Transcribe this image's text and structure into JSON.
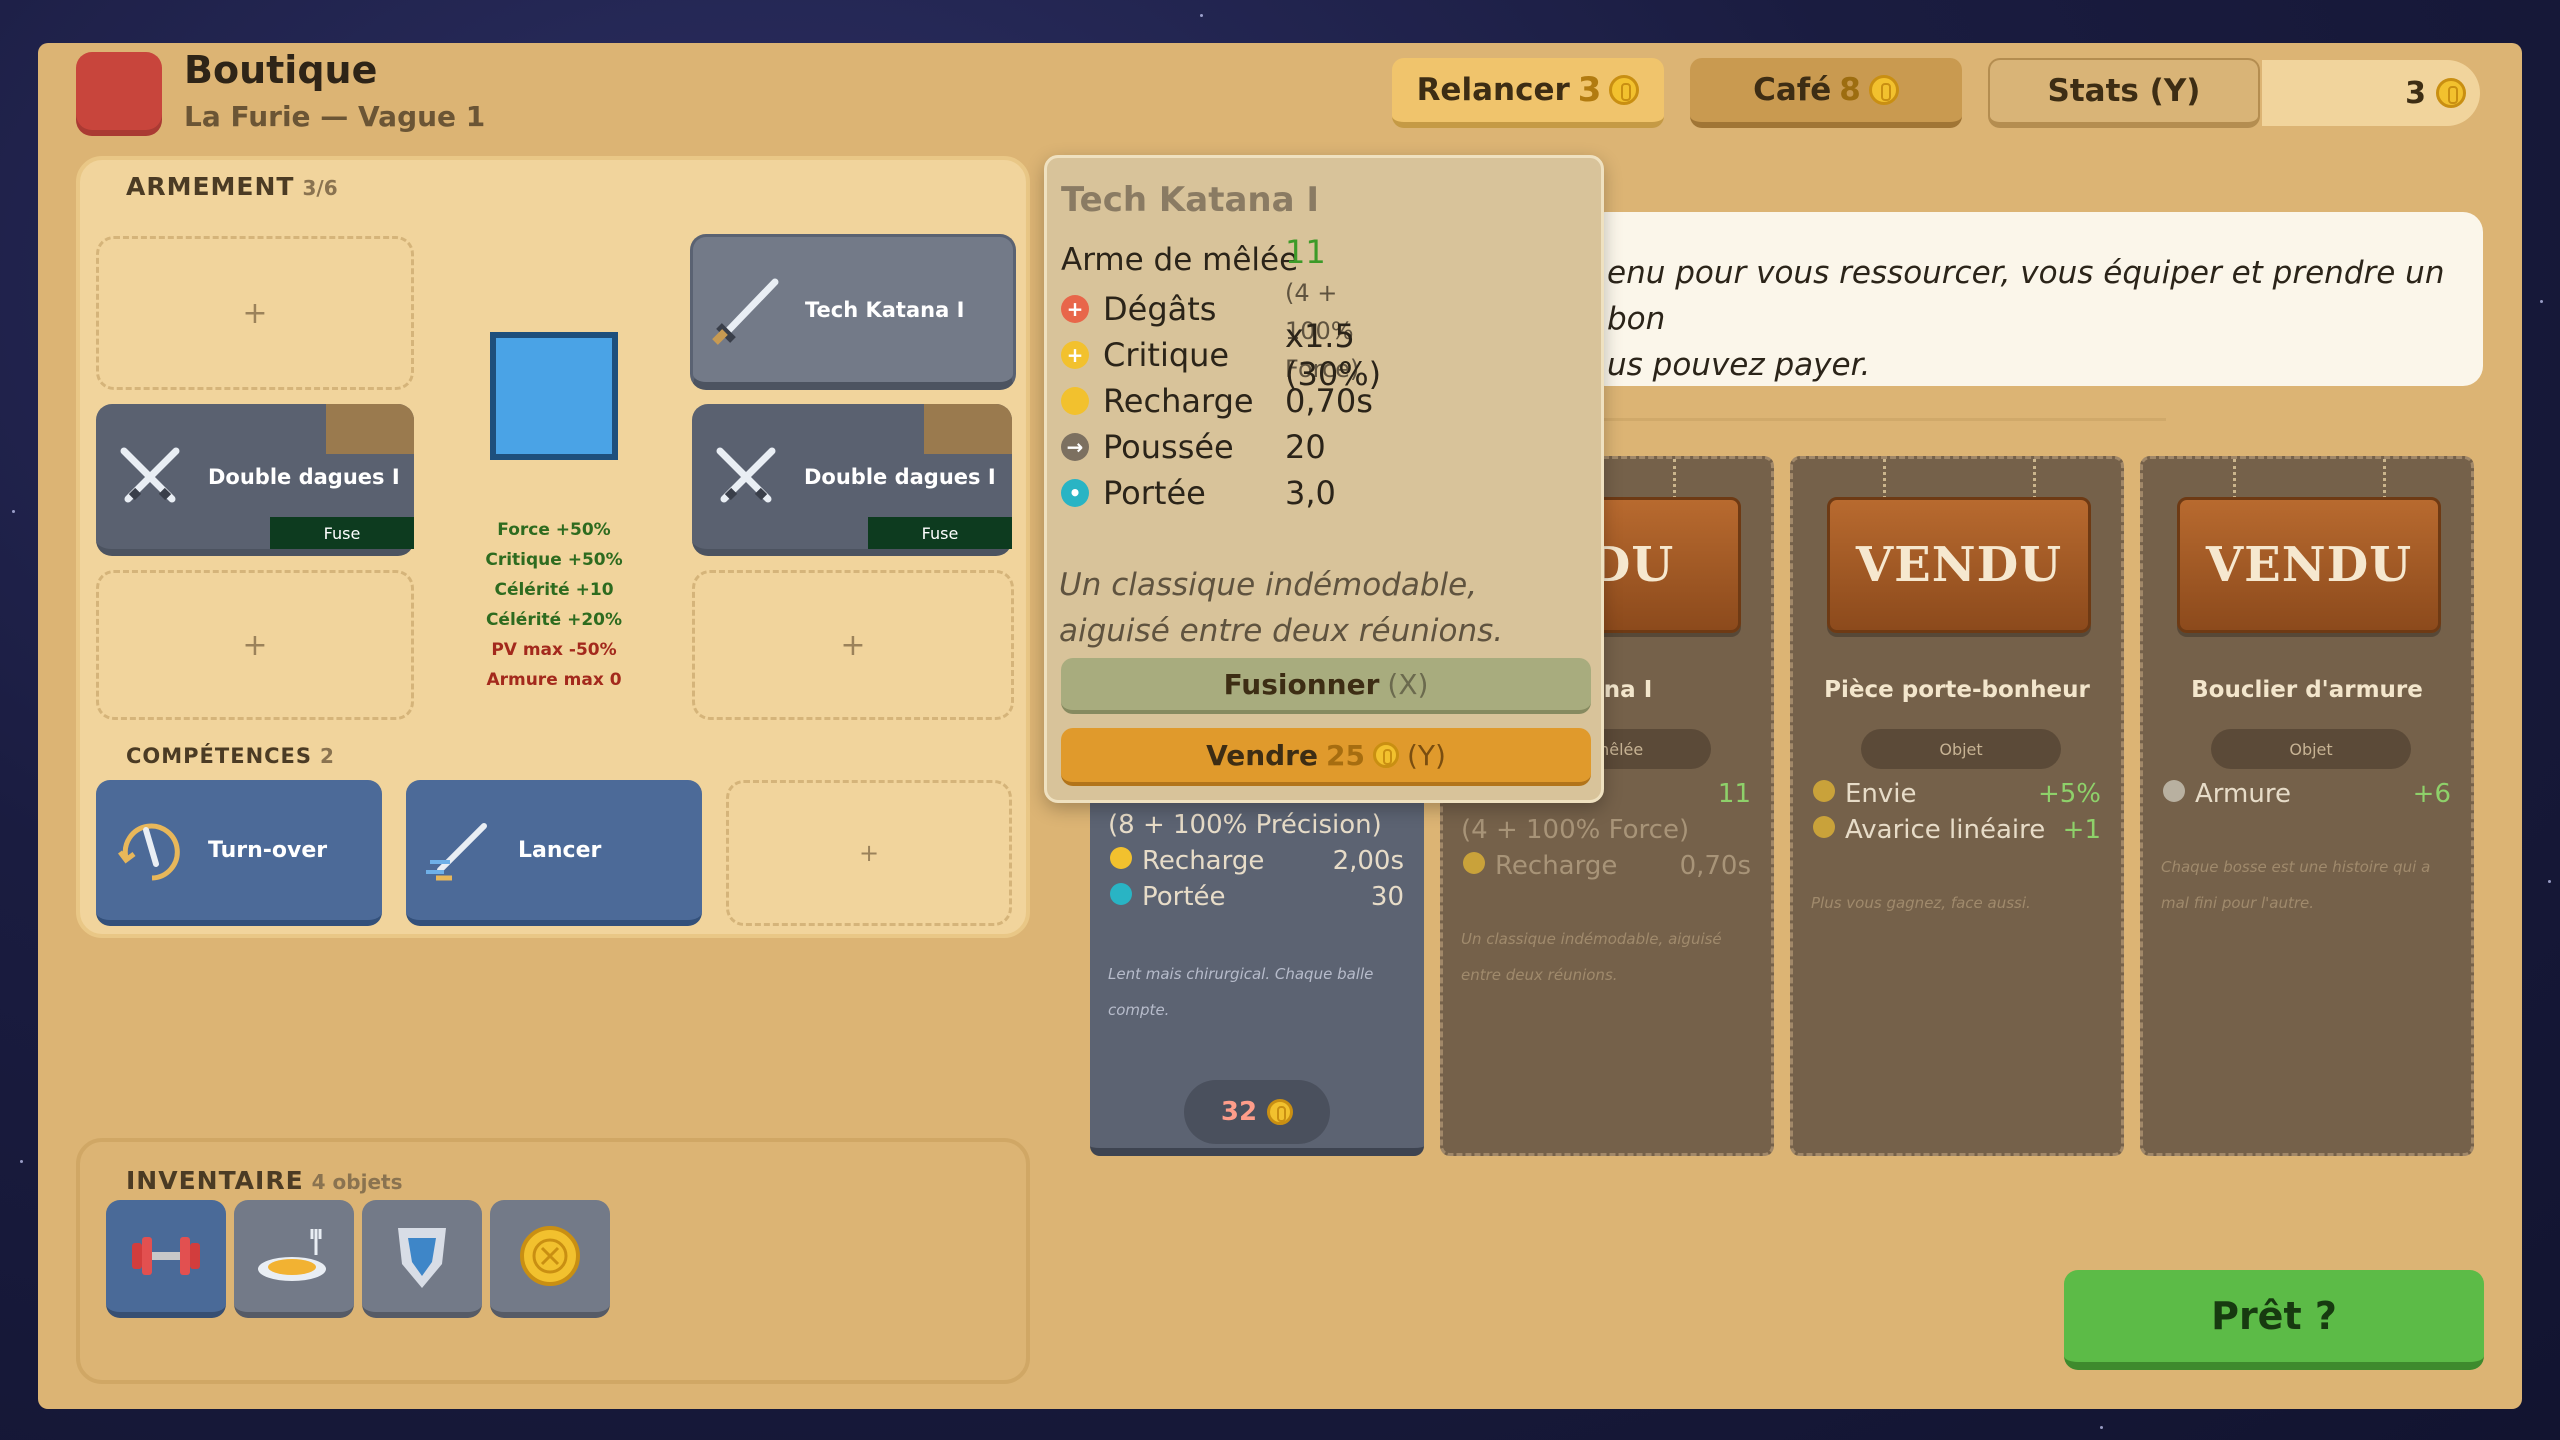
{
  "header": {
    "title": "Boutique",
    "subtitle": "La Furie — Vague 1",
    "reroll": {
      "label": "Relancer",
      "cost": "3"
    },
    "cafe": {
      "label": "Café",
      "cost": "8"
    },
    "stats": {
      "label": "Stats (Y)"
    },
    "gold": "3"
  },
  "armament": {
    "title": "ARMEMENT",
    "count": "3/6",
    "empty_slot": "+",
    "weapons": [
      {
        "name": "Tech Katana I"
      },
      {
        "name": "Double dagues I",
        "tag": "Fuse"
      },
      {
        "name": "Double dagues I",
        "tag": "Fuse"
      }
    ],
    "bonuses": [
      {
        "text": "Force +50%",
        "color": "#2e6b1f"
      },
      {
        "text": "Critique +50%",
        "color": "#2e6b1f"
      },
      {
        "text": "Célérité +10",
        "color": "#2e6b1f"
      },
      {
        "text": "Célérité +20%",
        "color": "#2e6b1f"
      },
      {
        "text": "PV max -50%",
        "color": "#a3291c"
      },
      {
        "text": "Armure max 0",
        "color": "#a3291c"
      }
    ]
  },
  "skills": {
    "title": "COMPÉTENCES",
    "count": "2",
    "items": [
      {
        "name": "Turn-over"
      },
      {
        "name": "Lancer"
      }
    ],
    "empty_slot": "+"
  },
  "inventory": {
    "title": "INVENTAIRE",
    "count": "4 objets",
    "items": [
      {
        "icon": "dumbbell-icon",
        "color": "#4a6a98"
      },
      {
        "icon": "plate-icon",
        "color": "#737a88"
      },
      {
        "icon": "shield-icon",
        "color": "#737a88"
      },
      {
        "icon": "coin-icon",
        "color": "#737a88"
      }
    ]
  },
  "tooltip": {
    "name": "Tech Katana I",
    "type": "Arme de mêlée",
    "stats": [
      {
        "label": "Dégâts",
        "value": "11",
        "detail": "(4 + 100% Force)",
        "icon": "damage-icon",
        "color": "#e8664a"
      },
      {
        "label": "Critique",
        "value": "x1.5 (30%)",
        "icon": "crit-icon",
        "color": "#f2c12e"
      },
      {
        "label": "Recharge",
        "value": "0,70s",
        "icon": "cooldown-icon",
        "color": "#f2c12e"
      },
      {
        "label": "Poussée",
        "value": "20",
        "icon": "knockback-icon",
        "color": "#7c7060"
      },
      {
        "label": "Portée",
        "value": "3,0",
        "icon": "range-icon",
        "color": "#29b4c4"
      }
    ],
    "flavor": "Un classique indémodable, aiguisé entre deux réunions.",
    "merge": {
      "label": "Fusionner",
      "key": "(X)"
    },
    "sell": {
      "label": "Vendre",
      "price": "25",
      "key": "(Y)"
    }
  },
  "shop": {
    "description": "enu pour vous ressourcer, vous équiper et prendre un bon us pouvez payer.",
    "desc_line1": "enu pour vous ressourcer, vous équiper et prendre un bon",
    "desc_line2": "us pouvez payer.",
    "cards": [
      {
        "state": "for-sale",
        "stat_detail": "(8 + 100% Précision)",
        "stats": [
          {
            "label": "Recharge",
            "value": "2,00s"
          },
          {
            "label": "Portée",
            "value": "30"
          }
        ],
        "flavor": "Lent mais chirurgical. Chaque balle compte.",
        "price": "32"
      },
      {
        "state": "sold",
        "sign": "NDU",
        "name": "atana I",
        "pill": "e mêlée",
        "stat_top_value": "11",
        "stat_detail": "(4 + 100% Force)",
        "stats": [
          {
            "label": "Recharge",
            "value": "0,70s"
          }
        ],
        "flavor": "Un classique indémodable, aiguisé entre deux réunions."
      },
      {
        "state": "sold",
        "sign": "VENDU",
        "name": "Pièce porte-bonheur",
        "pill": "Objet",
        "stats": [
          {
            "label": "Envie",
            "value": "+5%"
          },
          {
            "label": "Avarice linéaire",
            "value": "+1"
          }
        ],
        "flavor": "Plus vous gagnez, face aussi."
      },
      {
        "state": "sold",
        "sign": "VENDU",
        "name": "Bouclier d'armure",
        "pill": "Objet",
        "stats": [
          {
            "label": "Armure",
            "value": "+6"
          }
        ],
        "flavor": "Chaque bosse est une histoire qui a mal fini pour l'autre."
      }
    ]
  },
  "ready": {
    "label": "Prêt ?"
  }
}
